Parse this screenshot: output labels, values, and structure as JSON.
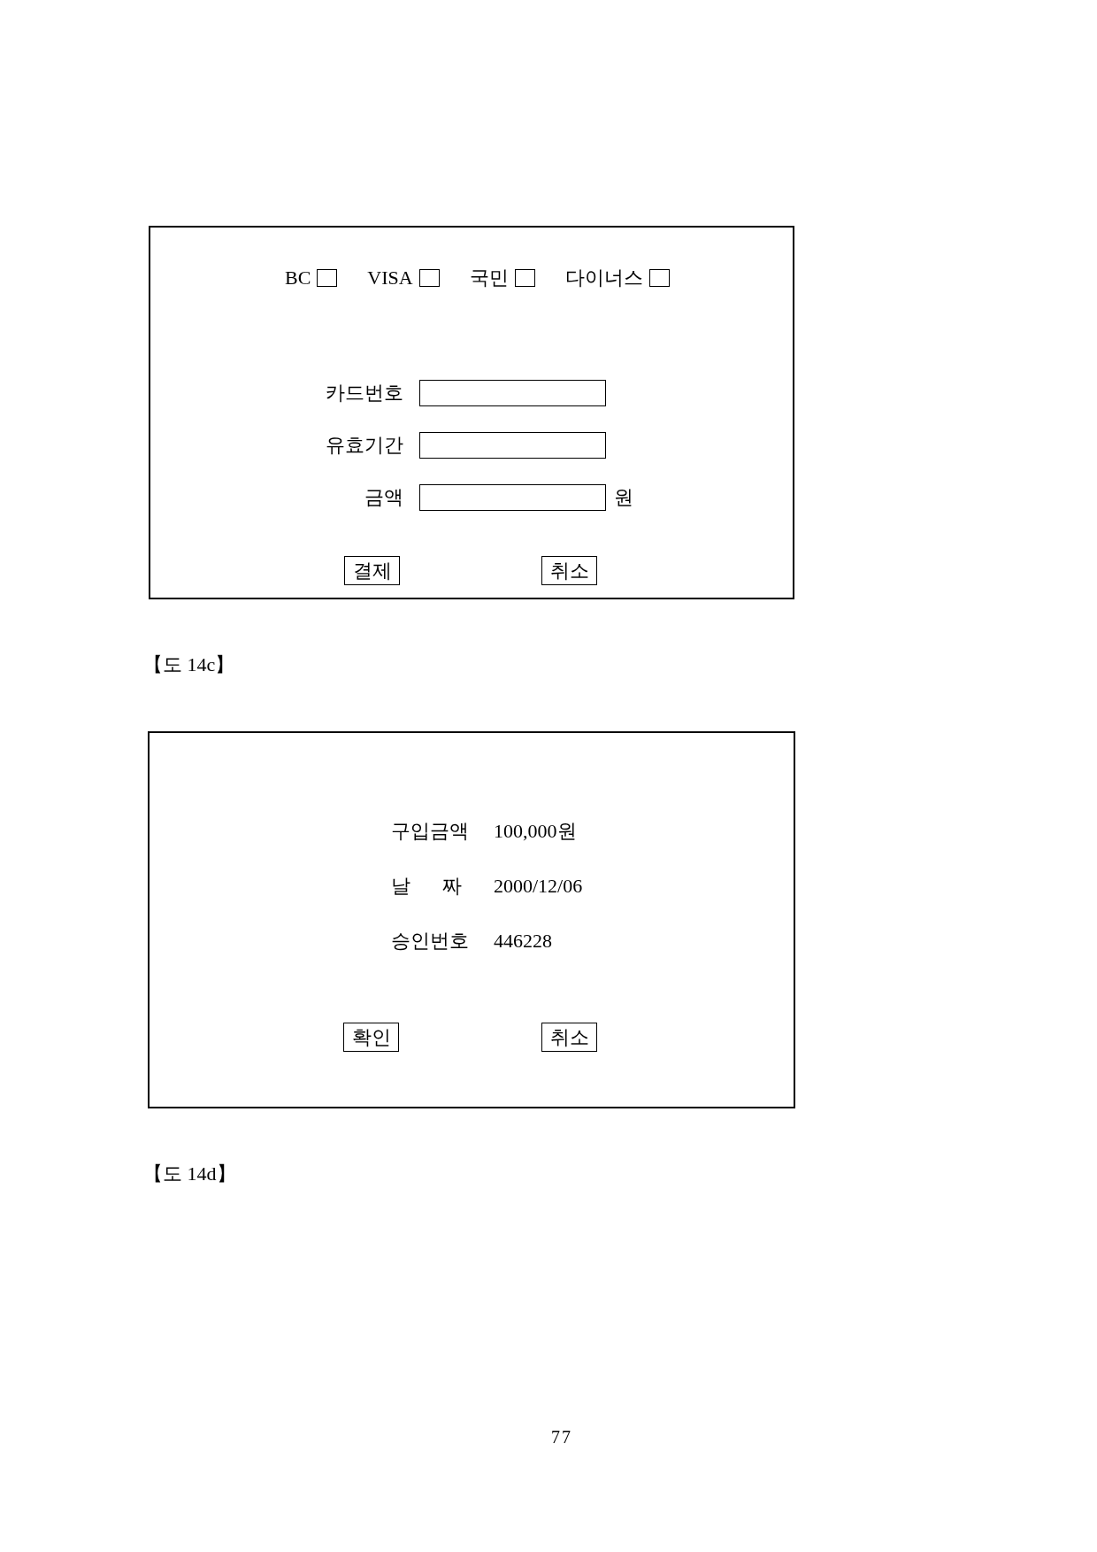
{
  "figures": [
    {
      "kind": "payment_form",
      "card_types": [
        {
          "label": "BC",
          "checked": false
        },
        {
          "label": "VISA",
          "checked": false
        },
        {
          "label": "국민",
          "checked": false
        },
        {
          "label": "다이너스",
          "checked": false
        }
      ],
      "fields": [
        {
          "label": "카드번호"
        },
        {
          "label": "유효기간"
        },
        {
          "label": "금액",
          "unit": "원"
        }
      ],
      "buttons": [
        "결제",
        "취소"
      ],
      "caption": "【도 14c】"
    },
    {
      "kind": "approval_summary",
      "rows": [
        {
          "label": "구입금액",
          "value": "100,000원"
        },
        {
          "label": "날 짜",
          "value": "2000/12/06"
        },
        {
          "label": "승인번호",
          "value": "446228"
        }
      ],
      "buttons": [
        "확인",
        "취소"
      ],
      "caption": "【도 14d】"
    }
  ],
  "page_number": "77"
}
